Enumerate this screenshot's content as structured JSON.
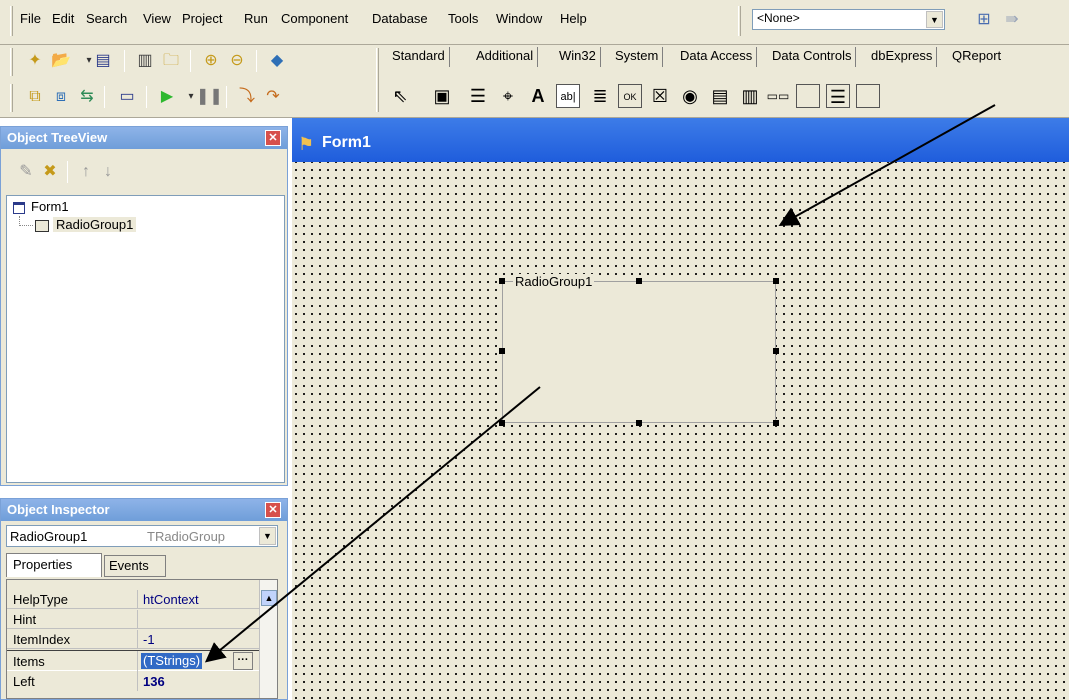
{
  "menu": [
    "File",
    "Edit",
    "Search",
    "View",
    "Project",
    "Run",
    "Component",
    "Database",
    "Tools",
    "Window",
    "Help"
  ],
  "combo_value": "<None>",
  "palette_tabs": [
    "Standard",
    "Additional",
    "Win32",
    "System",
    "Data Access",
    "Data Controls",
    "dbExpress",
    "QReport"
  ],
  "treeview": {
    "title": "Object TreeView",
    "items": [
      "Form1",
      "RadioGroup1"
    ]
  },
  "inspector": {
    "title": "Object Inspector",
    "object_name": "RadioGroup1",
    "object_type": "TRadioGroup",
    "tabs": [
      "Properties",
      "Events"
    ],
    "properties": [
      {
        "name": "HelpType",
        "value": "htContext"
      },
      {
        "name": "Hint",
        "value": ""
      },
      {
        "name": "ItemIndex",
        "value": "-1"
      },
      {
        "name": "Items",
        "value": "(TStrings)"
      },
      {
        "name": "Left",
        "value": "136"
      }
    ]
  },
  "form": {
    "title": "Form1",
    "radiogroup_caption": "RadioGroup1"
  },
  "colors": {
    "accent": "#316ac5",
    "title_bar": "#1f5ddc",
    "panel_title": "#7aa7e3"
  }
}
